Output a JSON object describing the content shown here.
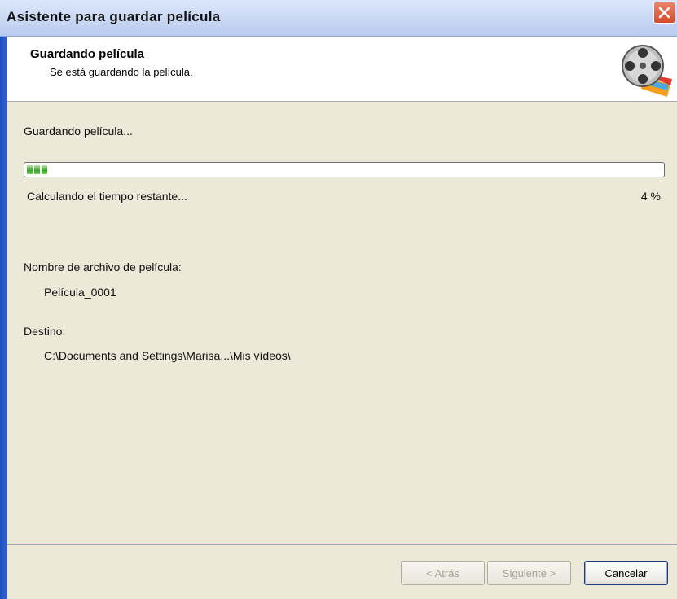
{
  "window": {
    "title": "Asistente para guardar película"
  },
  "header": {
    "title": "Guardando película",
    "subtitle": "Se está guardando la película."
  },
  "main": {
    "status_text": "Guardando película...",
    "progress_percent": 4,
    "time_remaining_text": "Calculando el tiempo restante...",
    "percent_label": "4 %",
    "filename_label": "Nombre de archivo de película:",
    "filename_value": "Película_0001",
    "destination_label": "Destino:",
    "destination_value": "C:\\Documents and Settings\\Marisa...\\Mis vídeos\\"
  },
  "buttons": {
    "back": "< Atrás",
    "next": "Siguiente >",
    "cancel": "Cancelar"
  },
  "icons": {
    "close": "close-icon",
    "app": "film-reel-icon"
  },
  "colors": {
    "close_button": "#d44a2b",
    "progress_fill": "#3aa629",
    "window_frame": "#2b5fd0"
  }
}
